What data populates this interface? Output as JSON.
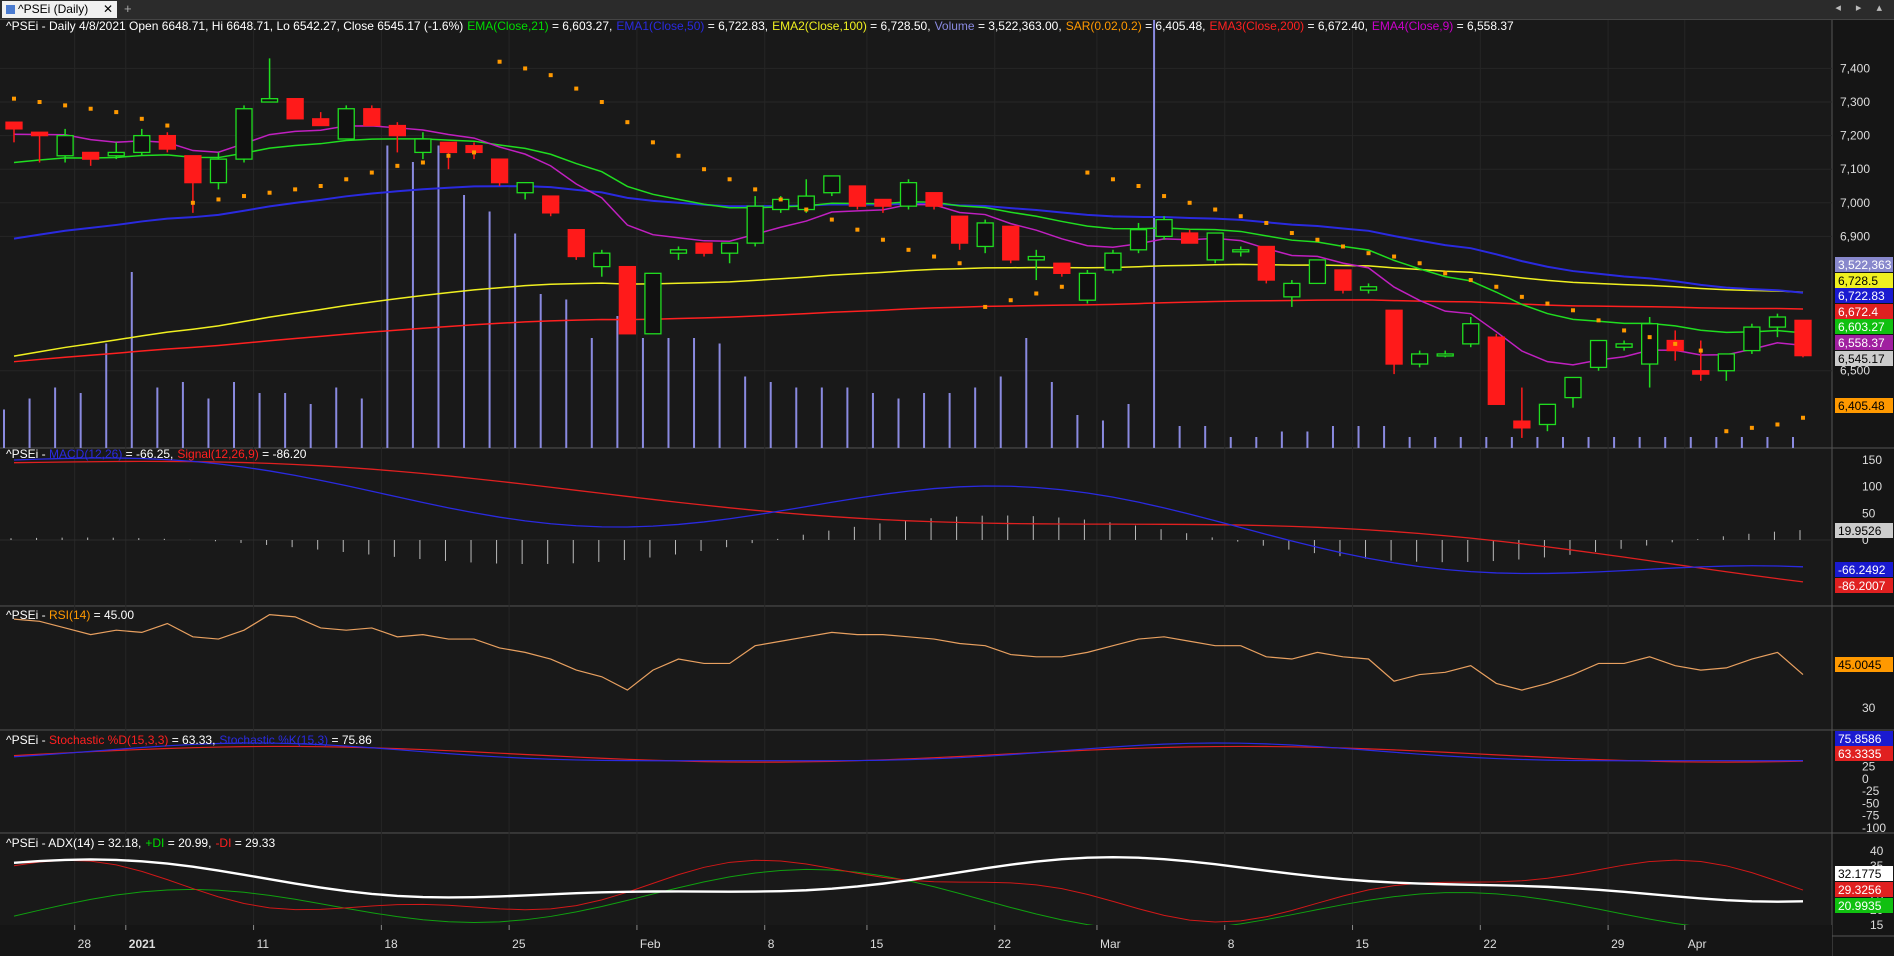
{
  "tab": {
    "title": "^PSEi (Daily)",
    "close": "✕",
    "add": "+"
  },
  "nav_arrows": "◂ ▸ ▴",
  "panels": {
    "price": {
      "prefix": "^PSEi - Daily 4/8/2021 Open 6648.71, Hi 6648.71, Lo 6542.27, Close 6545.17 (-1.6%)",
      "legend": [
        {
          "label": "EMA(Close,21)",
          "value": " = 6,603.27,",
          "color": "#00dd00"
        },
        {
          "label": "EMA1(Close,50)",
          "value": " = 6,722.83,",
          "color": "#2a2ae0"
        },
        {
          "label": "EMA2(Close,100)",
          "value": " = 6,728.50,",
          "color": "#f0f020"
        },
        {
          "label": "Volume",
          "value": " = 3,522,363.00,",
          "color": "#8a8ae0"
        },
        {
          "label": "SAR(0.02,0.2)",
          "value": " = 6,405.48,",
          "color": "#ff9900"
        },
        {
          "label": "EMA3(Close,200)",
          "value": " = 6,672.40,",
          "color": "#ff2020"
        },
        {
          "label": "EMA4(Close,9)",
          "value": " = 6,558.37",
          "color": "#cc00cc"
        }
      ],
      "y_ticks": [
        "7,400",
        "7,300",
        "7,200",
        "7,100",
        "7,000",
        "6,900",
        "6,500"
      ],
      "badges": [
        {
          "text": "3,522,363",
          "bg": "#8888cc",
          "fg": "#ffffff"
        },
        {
          "text": "6,728.5",
          "bg": "#f0f020",
          "fg": "#000000"
        },
        {
          "text": "6,722.83",
          "bg": "#1a1ad0",
          "fg": "#ffffff"
        },
        {
          "text": "6,672.4",
          "bg": "#e02020",
          "fg": "#ffffff"
        },
        {
          "text": "6,603.27",
          "bg": "#10c010",
          "fg": "#ffffff"
        },
        {
          "text": "6,558.37",
          "bg": "#a020a0",
          "fg": "#ffffff"
        },
        {
          "text": "6,545.17",
          "bg": "#cccccc",
          "fg": "#000000"
        },
        {
          "text": "6,405.48",
          "bg": "#ff9900",
          "fg": "#000000"
        }
      ]
    },
    "macd": {
      "prefix": "^PSEi - ",
      "legend": [
        {
          "label": "MACD(12,26)",
          "value": " = -66.25,",
          "color": "#2a2ae0"
        },
        {
          "label": "Signal(12,26,9)",
          "value": " = -86.20",
          "color": "#ff2020"
        }
      ],
      "y_ticks": [
        "150",
        "100",
        "50",
        "0"
      ],
      "badges": [
        {
          "text": "19.9526",
          "bg": "#cccccc",
          "fg": "#000000"
        },
        {
          "text": "-66.2492",
          "bg": "#1a1ad0",
          "fg": "#ffffff"
        },
        {
          "text": "-86.2007",
          "bg": "#e02020",
          "fg": "#ffffff"
        }
      ]
    },
    "rsi": {
      "prefix": "^PSEi - ",
      "legend": [
        {
          "label": "RSI(14)",
          "value": " = 45.00",
          "color": "#ff9900"
        }
      ],
      "y_ticks": [
        "30"
      ],
      "badges": [
        {
          "text": "45.0045",
          "bg": "#ff9900",
          "fg": "#000000"
        }
      ]
    },
    "stoch": {
      "prefix": "^PSEi - ",
      "legend": [
        {
          "label": "Stochastic %D(15,3,3)",
          "value": " = 63.33,",
          "color": "#ff2020"
        },
        {
          "label": "Stochastic %K(15,3)",
          "value": " = 75.86",
          "color": "#2a2ae0"
        }
      ],
      "y_ticks": [
        "50",
        "25",
        "0",
        "-25",
        "-50",
        "-75",
        "-100"
      ],
      "badges": [
        {
          "text": "75.8586",
          "bg": "#1a1ad0",
          "fg": "#ffffff"
        },
        {
          "text": "63.3335",
          "bg": "#e02020",
          "fg": "#ffffff"
        }
      ]
    },
    "adx": {
      "prefix": "^PSEi - ADX(14) = 32.18,",
      "legend": [
        {
          "label": "+DI",
          "value": " = 20.99,",
          "color": "#00dd00"
        },
        {
          "label": "-DI",
          "value": " = 29.33",
          "color": "#ff2020"
        }
      ],
      "y_ticks": [
        "40",
        "35",
        "25",
        "20",
        "15"
      ],
      "badges": [
        {
          "text": "32.1775",
          "bg": "#ffffff",
          "fg": "#000000"
        },
        {
          "text": "29.3256",
          "bg": "#e02020",
          "fg": "#ffffff"
        },
        {
          "text": "20.9935",
          "bg": "#10c010",
          "fg": "#ffffff"
        }
      ]
    }
  },
  "x_labels": [
    {
      "label": "28",
      "i": 3
    },
    {
      "label": "2021",
      "i": 5
    },
    {
      "label": "11",
      "i": 10
    },
    {
      "label": "18",
      "i": 15
    },
    {
      "label": "25",
      "i": 20
    },
    {
      "label": "Feb",
      "i": 25
    },
    {
      "label": "8",
      "i": 30
    },
    {
      "label": "15",
      "i": 34
    },
    {
      "label": "22",
      "i": 39
    },
    {
      "label": "Mar",
      "i": 43
    },
    {
      "label": "8",
      "i": 48
    },
    {
      "label": "15",
      "i": 53
    },
    {
      "label": "22",
      "i": 58
    },
    {
      "label": "29",
      "i": 63
    },
    {
      "label": "Apr",
      "i": 66
    }
  ],
  "chart_data": {
    "type": "candlestick",
    "ylim": [
      6270,
      7440
    ],
    "candles": [
      [
        7240,
        7240,
        7180,
        7220
      ],
      [
        7210,
        7210,
        7120,
        7200
      ],
      [
        7140,
        7220,
        7120,
        7200
      ],
      [
        7150,
        7150,
        7110,
        7130
      ],
      [
        7140,
        7180,
        7130,
        7150
      ],
      [
        7150,
        7220,
        7140,
        7200
      ],
      [
        7200,
        7210,
        7150,
        7160
      ],
      [
        7140,
        7140,
        6970,
        7060
      ],
      [
        7060,
        7150,
        7040,
        7130
      ],
      [
        7130,
        7290,
        7120,
        7280
      ],
      [
        7300,
        7430,
        7300,
        7310
      ],
      [
        7310,
        7310,
        7250,
        7250
      ],
      [
        7250,
        7270,
        7230,
        7230
      ],
      [
        7190,
        7290,
        7190,
        7280
      ],
      [
        7280,
        7290,
        7230,
        7230
      ],
      [
        7230,
        7240,
        7150,
        7200
      ],
      [
        7150,
        7210,
        7130,
        7190
      ],
      [
        7180,
        7180,
        7100,
        7150
      ],
      [
        7170,
        7180,
        7130,
        7150
      ],
      [
        7130,
        7130,
        7050,
        7060
      ],
      [
        7030,
        7060,
        7010,
        7060
      ],
      [
        7020,
        7020,
        6960,
        6970
      ],
      [
        6920,
        6920,
        6830,
        6840
      ],
      [
        6810,
        6860,
        6780,
        6850
      ],
      [
        6810,
        6810,
        6610,
        6610
      ],
      [
        6610,
        6790,
        6610,
        6790
      ],
      [
        6850,
        6870,
        6830,
        6860
      ],
      [
        6880,
        6880,
        6840,
        6850
      ],
      [
        6850,
        6880,
        6820,
        6880
      ],
      [
        6880,
        7020,
        6870,
        6990
      ],
      [
        6980,
        7020,
        6970,
        7010
      ],
      [
        6980,
        7070,
        6970,
        7020
      ],
      [
        7030,
        7080,
        7020,
        7080
      ],
      [
        7050,
        7050,
        6980,
        6990
      ],
      [
        7010,
        7010,
        6970,
        6990
      ],
      [
        6990,
        7070,
        6980,
        7060
      ],
      [
        7030,
        7030,
        6980,
        6990
      ],
      [
        6960,
        6960,
        6860,
        6880
      ],
      [
        6870,
        6950,
        6850,
        6940
      ],
      [
        6930,
        6930,
        6820,
        6830
      ],
      [
        6830,
        6860,
        6770,
        6840
      ],
      [
        6820,
        6820,
        6780,
        6790
      ],
      [
        6710,
        6800,
        6700,
        6790
      ],
      [
        6800,
        6860,
        6790,
        6850
      ],
      [
        6860,
        6940,
        6850,
        6920
      ],
      [
        6900,
        6960,
        6890,
        6950
      ],
      [
        6910,
        6920,
        6880,
        6880
      ],
      [
        6830,
        6910,
        6820,
        6910
      ],
      [
        6860,
        6870,
        6840,
        6860
      ],
      [
        6870,
        6870,
        6760,
        6770
      ],
      [
        6720,
        6770,
        6690,
        6760
      ],
      [
        6760,
        6830,
        6760,
        6830
      ],
      [
        6800,
        6800,
        6730,
        6740
      ],
      [
        6740,
        6760,
        6730,
        6750
      ],
      [
        6680,
        6680,
        6490,
        6520
      ],
      [
        6520,
        6560,
        6510,
        6550
      ],
      [
        6550,
        6560,
        6540,
        6550
      ],
      [
        6580,
        6660,
        6570,
        6640
      ],
      [
        6600,
        6610,
        6400,
        6400
      ],
      [
        6350,
        6450,
        6300,
        6330
      ],
      [
        6340,
        6400,
        6320,
        6400
      ],
      [
        6420,
        6480,
        6390,
        6480
      ],
      [
        6510,
        6590,
        6500,
        6590
      ],
      [
        6570,
        6590,
        6560,
        6580
      ],
      [
        6520,
        6660,
        6450,
        6640
      ],
      [
        6590,
        6620,
        6530,
        6560
      ],
      [
        6500,
        6590,
        6470,
        6490
      ],
      [
        6500,
        6540,
        6470,
        6550
      ],
      [
        6560,
        6640,
        6550,
        6630
      ],
      [
        6630,
        6670,
        6600,
        6660
      ],
      [
        6650,
        6650,
        6540,
        6545
      ]
    ]
  }
}
